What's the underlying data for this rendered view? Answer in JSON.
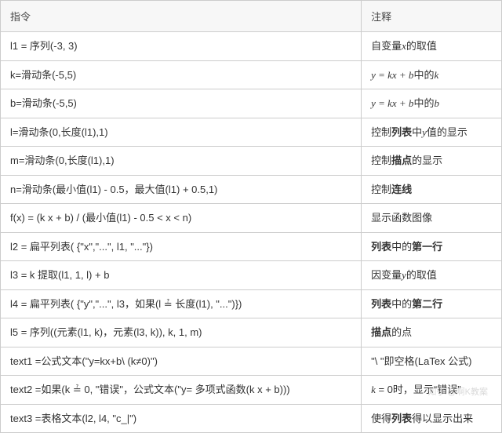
{
  "header": {
    "cmd": "指令",
    "note": "注释"
  },
  "rows": [
    {
      "cmd_html": "l1 = 序列(-3, 3)",
      "note_html": "自变量<i class='math'>x</i>的取值"
    },
    {
      "cmd_html": "k=滑动条(-5,5)",
      "note_html": "<i class='math'>y = kx + b</i>中的<i class='math'>k</i>"
    },
    {
      "cmd_html": "b=滑动条(-5,5)",
      "note_html": "<i class='math'>y = kx + b</i>中的<i class='math'>b</i>"
    },
    {
      "cmd_html": "l=滑动条(0,长度(l1),1)",
      "note_html": "控制<b>列表</b>中<i class='math'>y</i>值的显示"
    },
    {
      "cmd_html": "m=滑动条(0,长度(l1),1)",
      "note_html": "控制<b>描点</b>的显示"
    },
    {
      "cmd_html": "n=滑动条(最小值(l1) - 0.5，最大值(l1) + 0.5,1)",
      "note_html": "控制<b>连线</b>"
    },
    {
      "cmd_html": "f(x) = (k x + b) / (最小值(l1) - 0.5 &lt; x &lt; n)",
      "note_html": "显示函数图像"
    },
    {
      "cmd_html": "l2 = 扁平列表( {\"x\",\"...\", l1, \"...\"})",
      "note_html": "<b>列表</b>中的<b>第一行</b>"
    },
    {
      "cmd_html": "l3 = k 提取(l1, 1, l) + b",
      "note_html": "因变量<i class='math'>y</i>的取值"
    },
    {
      "cmd_html": "l4 = 扁平列表( {\"y\",\"...\", l3，如果(l ≟ 长度(l1), \"...\")})",
      "note_html": "<b>列表</b>中的<b>第二行</b>"
    },
    {
      "cmd_html": "l5 = 序列((元素(l1, k)，元素(l3, k)), k, 1, m)",
      "note_html": "<b>描点</b>的点"
    },
    {
      "cmd_html": "text1 =公式文本(\"y=kx+b\\ (k≠0)\")",
      "note_html": "\"\\ \"即空格(LaTex 公式)"
    },
    {
      "cmd_html": "text2 =如果(k ≟ 0, \"错误\"，公式文本(\"y=  多项式函数(k x + b)))",
      "note_html": "<i class='math'>k</i> = 0时，显示“错误”"
    },
    {
      "cmd_html": "text3 =表格文本(l2, l4, \"c_|\")",
      "note_html": "使得<b>列表</b>得以显示出来"
    }
  ],
  "watermark": "知乎 @啊K教案"
}
